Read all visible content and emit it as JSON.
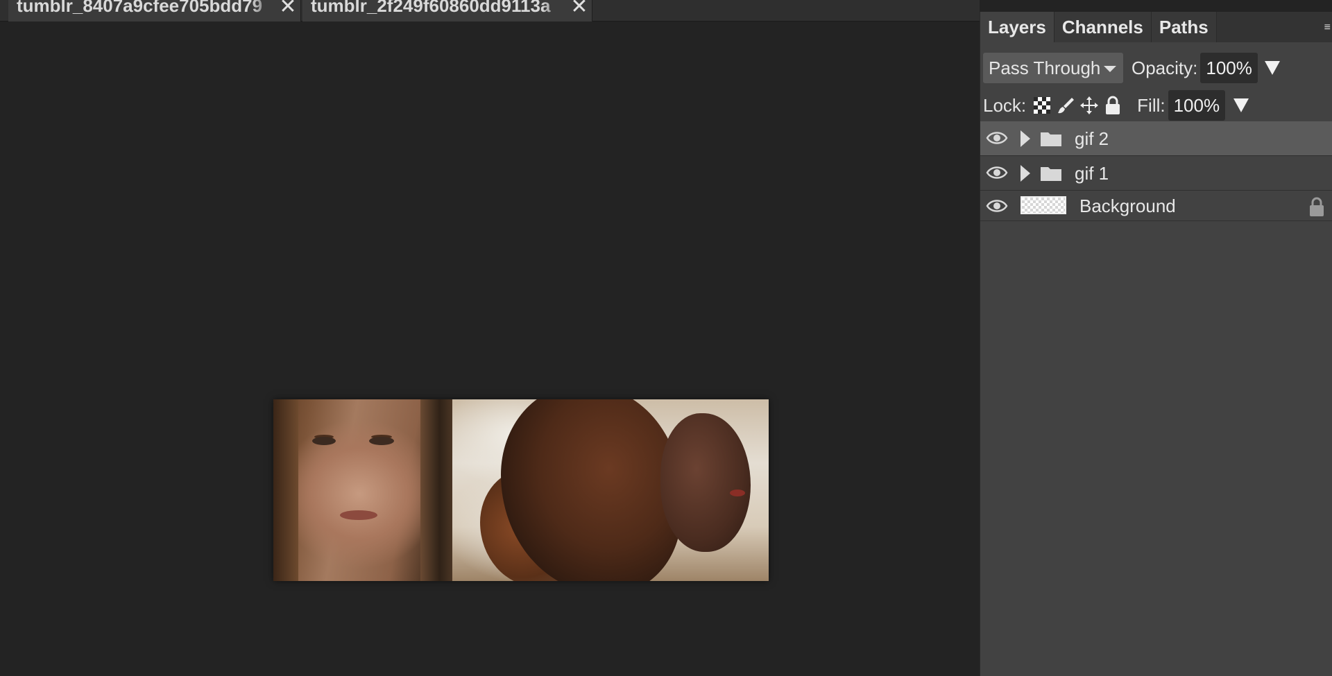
{
  "tabs": [
    {
      "name": "tumblr_8407a9cfee705bdd79",
      "close": "✕"
    },
    {
      "name": "tumblr_2f249f60860dd9113a",
      "close": "✕"
    }
  ],
  "panel": {
    "tabs": [
      "Layers",
      "Channels",
      "Paths"
    ],
    "active_tab": "Layers",
    "menu_icon": "≡",
    "blend_mode": "Pass Through",
    "opacity_label": "Opacity:",
    "opacity_value": "100%",
    "lock_label": "Lock:",
    "lock_icons": [
      "lock-transparent-icon",
      "lock-paint-icon",
      "lock-move-icon",
      "lock-all-icon"
    ],
    "fill_label": "Fill:",
    "fill_value": "100%"
  },
  "layers": [
    {
      "name": "gif 2",
      "type": "group",
      "visible": true,
      "selected": true
    },
    {
      "name": "gif 1",
      "type": "group",
      "visible": true,
      "selected": false
    },
    {
      "name": "Background",
      "type": "layer",
      "visible": true,
      "selected": false,
      "locked": true
    }
  ],
  "colors": {
    "canvas_bg": "#232323",
    "panel_bg": "#424242",
    "selected_row": "#5b5b5b"
  }
}
